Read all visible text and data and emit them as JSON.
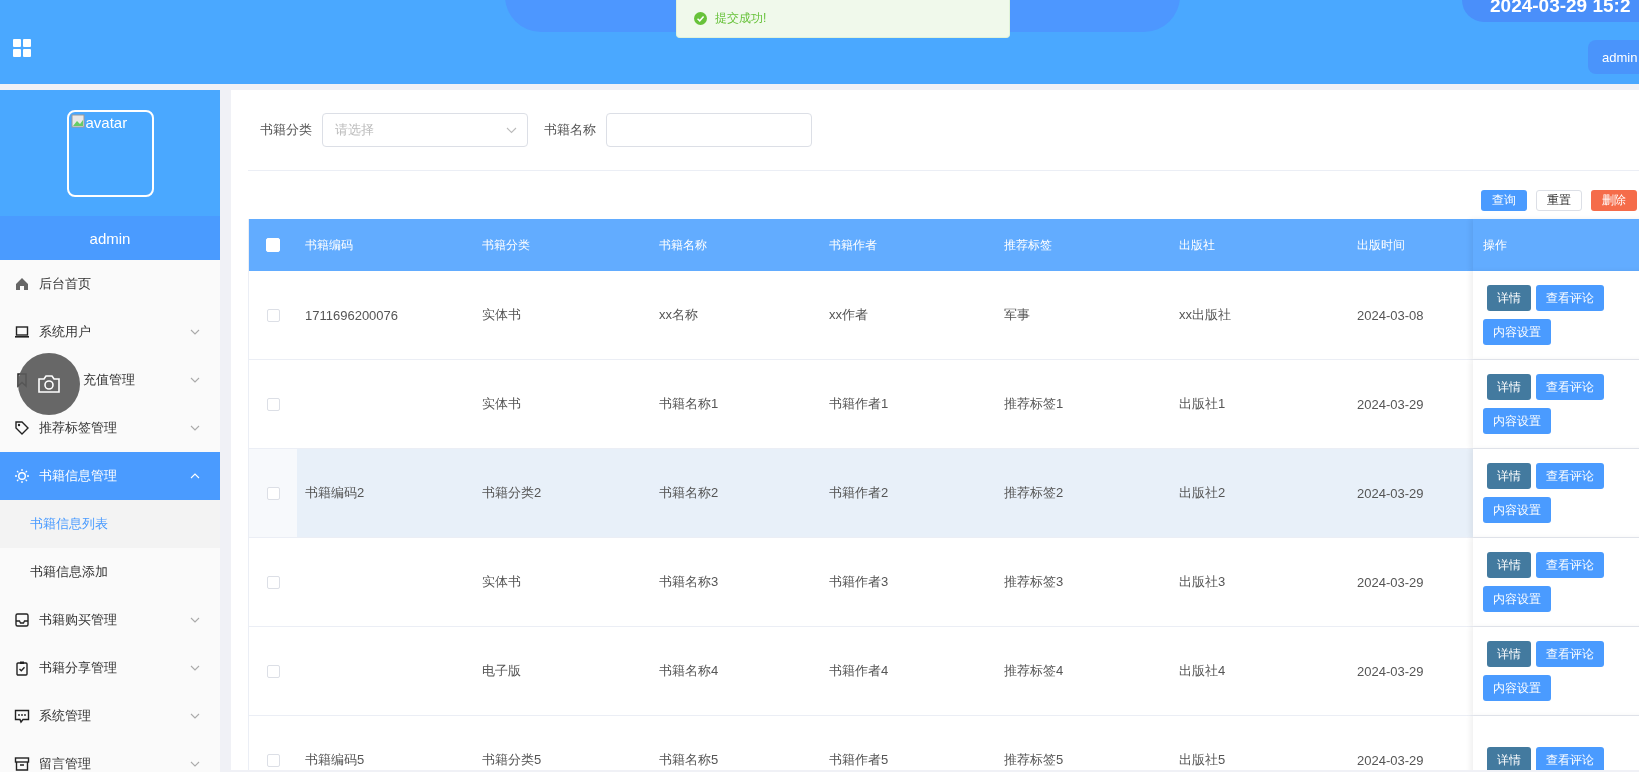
{
  "topbar": {
    "clock": "2024-03-29 15:2",
    "user_button": "admin",
    "toast": {
      "text": "提交成功!",
      "kind": "success"
    }
  },
  "overlay_button": {
    "kind": "camera"
  },
  "sidebar": {
    "avatar_alt": "avatar",
    "username": "admin",
    "items": [
      {
        "label": "后台首页",
        "selected": false,
        "covered": false
      },
      {
        "label": "系统用户",
        "selected": false,
        "expanded": false,
        "covered": false
      },
      {
        "label": "充值管理",
        "selected": false,
        "expanded": false,
        "covered": true
      },
      {
        "label": "推荐标签管理",
        "selected": false,
        "expanded": false,
        "covered": false
      },
      {
        "label": "书籍信息管理",
        "selected": true,
        "expanded": true,
        "covered": false,
        "children": [
          {
            "label": "书籍信息列表",
            "selected": true
          },
          {
            "label": "书籍信息添加",
            "selected": false
          }
        ]
      },
      {
        "label": "书籍购买管理",
        "selected": false,
        "expanded": false,
        "covered": false
      },
      {
        "label": "书籍分享管理",
        "selected": false,
        "expanded": false,
        "covered": false
      },
      {
        "label": "系统管理",
        "selected": false,
        "expanded": false,
        "covered": false
      },
      {
        "label": "留言管理",
        "selected": false,
        "expanded": false,
        "covered": false
      }
    ]
  },
  "filters": [
    {
      "label": "书籍分类",
      "kind": "select",
      "placeholder": "请选择"
    },
    {
      "label": "书籍名称",
      "kind": "text"
    }
  ],
  "actions": [
    {
      "label": "查询",
      "kind": "primary"
    },
    {
      "label": "重置",
      "kind": "plain"
    },
    {
      "label": "删除",
      "kind": "danger"
    }
  ],
  "table": {
    "select_all_checked": false,
    "columns": [
      "书籍编码",
      "书籍分类",
      "书籍名称",
      "书籍作者",
      "推荐标签",
      "出版社",
      "出版时间",
      "操作"
    ],
    "rows": [
      {
        "checked": false,
        "hovered": false,
        "cells": [
          "1711696200076",
          "实体书",
          "xx名称",
          "xx作者",
          "军事",
          "xx出版社",
          "2024-03-08"
        ],
        "buttons": [
          "详情",
          "查看评论",
          "内容设置"
        ]
      },
      {
        "checked": false,
        "hovered": false,
        "cells": [
          "",
          "实体书",
          "书籍名称1",
          "书籍作者1",
          "推荐标签1",
          "出版社1",
          "2024-03-29"
        ],
        "buttons": [
          "详情",
          "查看评论",
          "内容设置"
        ]
      },
      {
        "checked": false,
        "hovered": true,
        "cells": [
          "书籍编码2",
          "书籍分类2",
          "书籍名称2",
          "书籍作者2",
          "推荐标签2",
          "出版社2",
          "2024-03-29"
        ],
        "buttons": [
          "详情",
          "查看评论",
          "内容设置"
        ]
      },
      {
        "checked": false,
        "hovered": false,
        "cells": [
          "",
          "实体书",
          "书籍名称3",
          "书籍作者3",
          "推荐标签3",
          "出版社3",
          "2024-03-29"
        ],
        "buttons": [
          "详情",
          "查看评论",
          "内容设置"
        ]
      },
      {
        "checked": false,
        "hovered": false,
        "cells": [
          "",
          "电子版",
          "书籍名称4",
          "书籍作者4",
          "推荐标签4",
          "出版社4",
          "2024-03-29"
        ],
        "buttons": [
          "详情",
          "查看评论",
          "内容设置"
        ]
      },
      {
        "checked": false,
        "hovered": false,
        "cells": [
          "书籍编码5",
          "书籍分类5",
          "书籍名称5",
          "书籍作者5",
          "推荐标签5",
          "出版社5",
          "2024-03-29"
        ],
        "buttons": [
          "详情",
          "查看评论"
        ]
      }
    ]
  }
}
